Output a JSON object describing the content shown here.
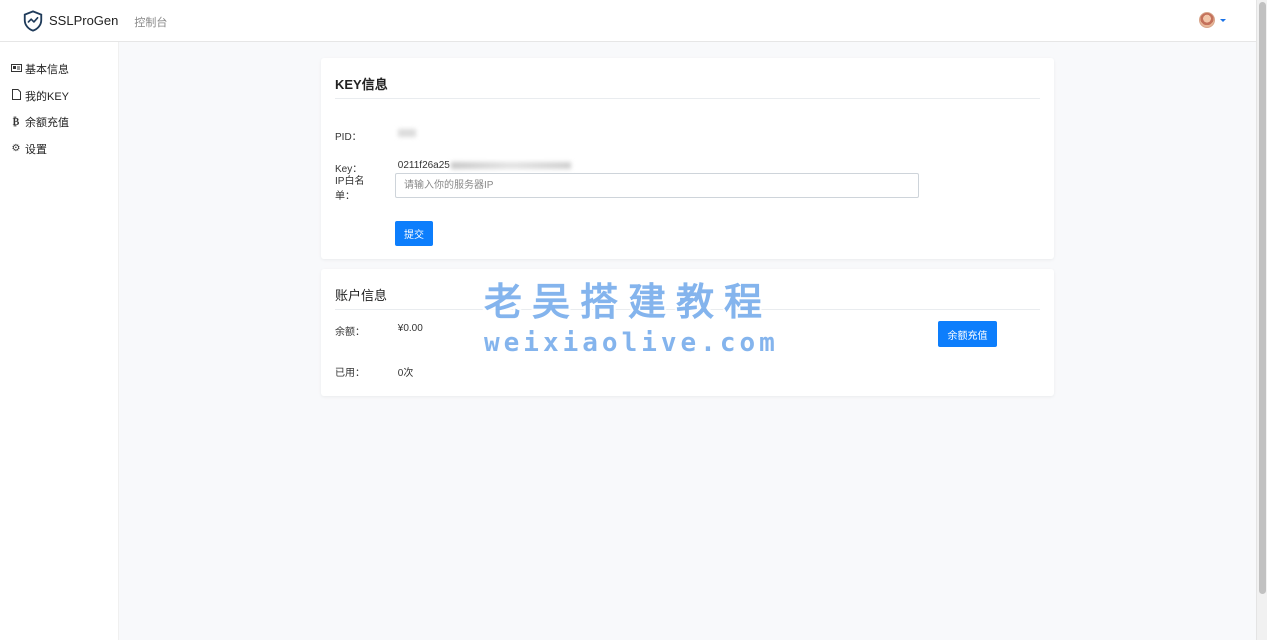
{
  "header": {
    "app_name": "SSLProGen",
    "console_label": "控制台"
  },
  "sidebar": {
    "items": [
      {
        "label": "基本信息",
        "icon": "id-card-icon"
      },
      {
        "label": "我的KEY",
        "icon": "file-icon"
      },
      {
        "label": "余额充值",
        "icon": "bitcoin-icon"
      },
      {
        "label": "设置",
        "icon": "gear-icon"
      }
    ]
  },
  "key_card": {
    "title": "KEY信息",
    "pid_label": "PID：",
    "key_label": "Key：",
    "key_value_prefix": "0211f26a25",
    "ip_label": "IP白名单：",
    "ip_placeholder": "请输入你的服务器IP",
    "submit_label": "提交"
  },
  "account_card": {
    "title": "账户信息",
    "balance_label": "余额：",
    "balance_value": "¥0.00",
    "recharge_label": "余额充值",
    "used_label": "已用：",
    "used_value": "0次"
  },
  "watermark": {
    "line1": "老吴搭建教程",
    "line2": "weixiaolive.com"
  },
  "colors": {
    "primary": "#0d7efc",
    "watermark": "#6fa8ea"
  }
}
